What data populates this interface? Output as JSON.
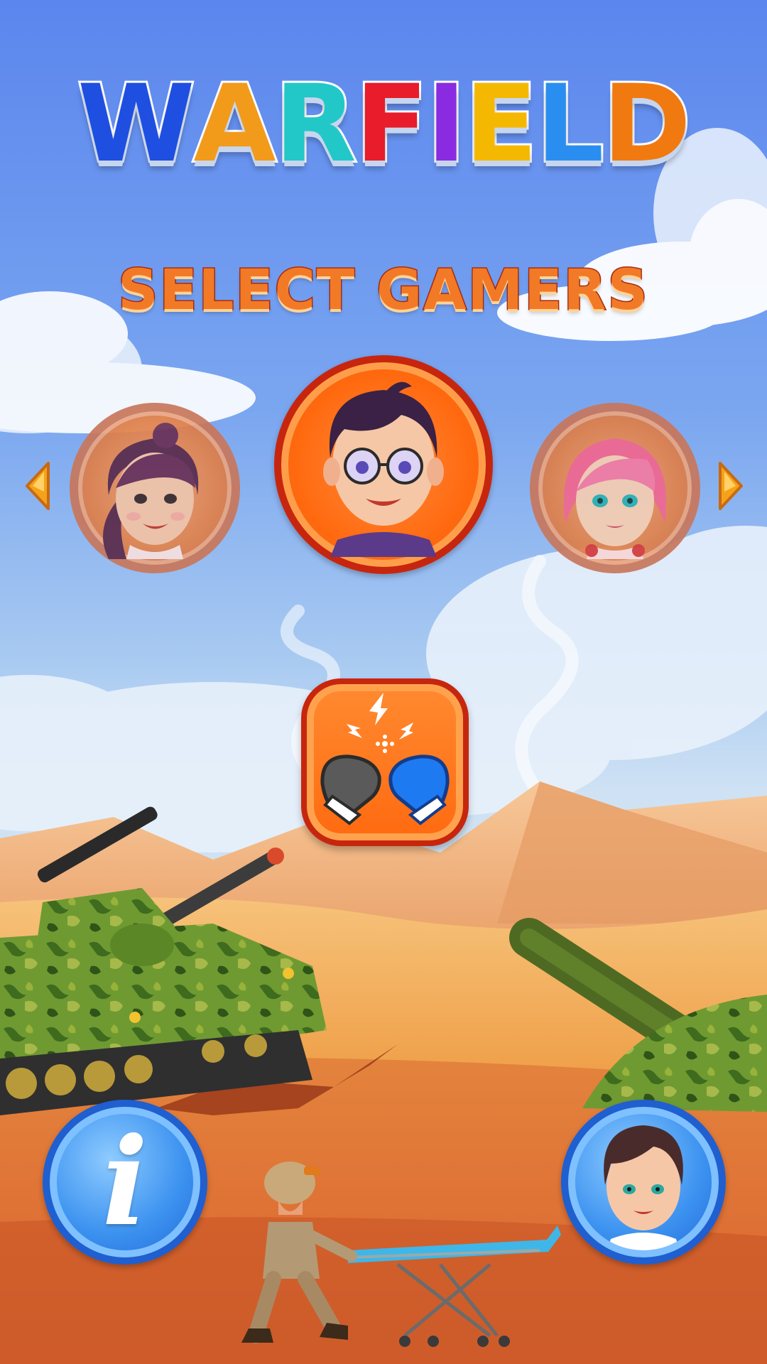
{
  "game": {
    "title_letters": [
      {
        "char": "W",
        "color": "#1f4fe0"
      },
      {
        "char": "A",
        "color": "#f29a1a"
      },
      {
        "char": "R",
        "color": "#22c8c8"
      },
      {
        "char": "F",
        "color": "#e81c2a"
      },
      {
        "char": "I",
        "color": "#8a2be2"
      },
      {
        "char": "E",
        "color": "#f5b800"
      },
      {
        "char": "L",
        "color": "#2a8ef0"
      },
      {
        "char": "D",
        "color": "#f07a10"
      }
    ]
  },
  "screen": {
    "heading": "SELECT GAMERS"
  },
  "gamers": [
    {
      "name": "girl-brunette-avatar",
      "selected": false
    },
    {
      "name": "boy-glasses-avatar",
      "selected": true
    },
    {
      "name": "girl-pink-hair-avatar",
      "selected": false
    }
  ],
  "controls": {
    "prev_icon": "arrow-left-icon",
    "next_icon": "arrow-right-icon",
    "versus_icon": "boxing-gloves-icon",
    "info_icon": "info-icon",
    "info_glyph": "i",
    "profile_icon": "player-avatar-icon"
  },
  "colors": {
    "accent_orange": "#ff6a10",
    "accent_red": "#c7260e",
    "accent_blue": "#1f5fd0",
    "sky": "#5b86ee",
    "sand": "#f0a24c"
  }
}
